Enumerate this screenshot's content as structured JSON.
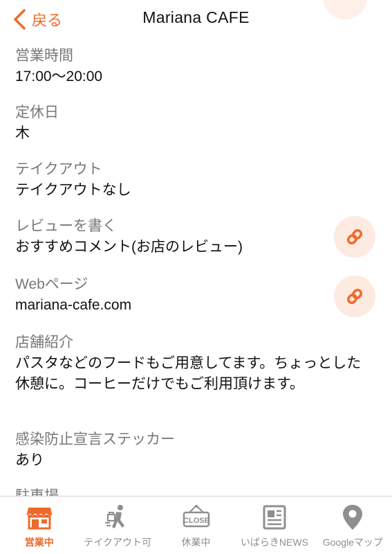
{
  "header": {
    "back_label": "戻る",
    "title": "Mariana CAFE"
  },
  "items": [
    {
      "label": "営業時間",
      "value": "17:00〜20:00"
    },
    {
      "label": "定休日",
      "value": "木"
    },
    {
      "label": "テイクアウト",
      "value": "テイクアウトなし"
    },
    {
      "label": "レビューを書く",
      "value": "おすすめコメント(お店のレビュー)"
    },
    {
      "label": "Webページ",
      "value": "mariana-cafe.com"
    },
    {
      "label": "店舗紹介",
      "value": "パスタなどのフードもご用意してます。ちょっとした休憩に。コーヒーだけでもご利用頂けます。"
    },
    {
      "label": "感染防止宣言ステッカー",
      "value": "あり"
    },
    {
      "label": "駐車場",
      "value": ""
    }
  ],
  "tabs": [
    {
      "label": "営業中",
      "icon": "store-icon",
      "active": true
    },
    {
      "label": "テイクアウト可",
      "icon": "takeout-runner-icon",
      "active": false
    },
    {
      "label": "休業中",
      "icon": "close-sign-icon",
      "active": false
    },
    {
      "label": "いばらきNEWS",
      "icon": "newspaper-icon",
      "active": false
    },
    {
      "label": "Googleマップ",
      "icon": "map-pin-icon",
      "active": false
    }
  ],
  "colors": {
    "accent": "#ef6a2a",
    "link_circle_bg": "#fdeae0",
    "label_gray": "#777777",
    "tab_gray": "#8e8e8e"
  }
}
